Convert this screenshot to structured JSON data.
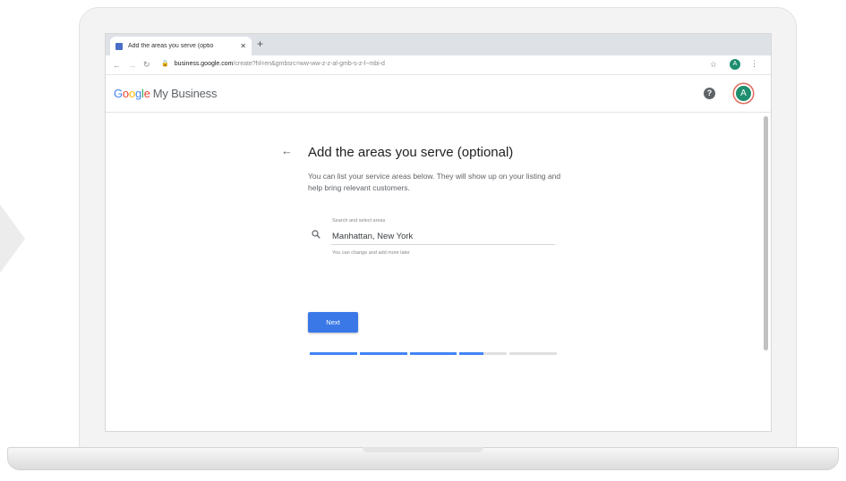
{
  "browser": {
    "tab_title": "Add the areas you serve (optio",
    "tab_close": "✕",
    "new_tab": "+",
    "url_host": "business.google.com",
    "url_path": "/create?hl=en&gmbsrc=ww-ww-z-z-al-gmb-s-z-l~mbi-d",
    "profile_initial": "A"
  },
  "app": {
    "logo_letters": [
      "G",
      "o",
      "o",
      "g",
      "l",
      "e"
    ],
    "product_name": "My Business",
    "help_symbol": "?",
    "avatar_initial": "A"
  },
  "page": {
    "back_symbol": "←",
    "title": "Add the areas you serve (optional)",
    "description": "You can list your service areas below. They will show up on your listing and help bring relevant customers.",
    "search": {
      "label": "Search and select areas",
      "value": "Manhattan, New York",
      "helper": "You can change and add more later"
    },
    "next_label": "Next"
  },
  "progress": {
    "segments": [
      1,
      1,
      1,
      0.5,
      0
    ]
  },
  "colors": {
    "accent": "#3b78e7",
    "progress_fill": "#4285f4",
    "avatar": "#1e8e6e"
  }
}
